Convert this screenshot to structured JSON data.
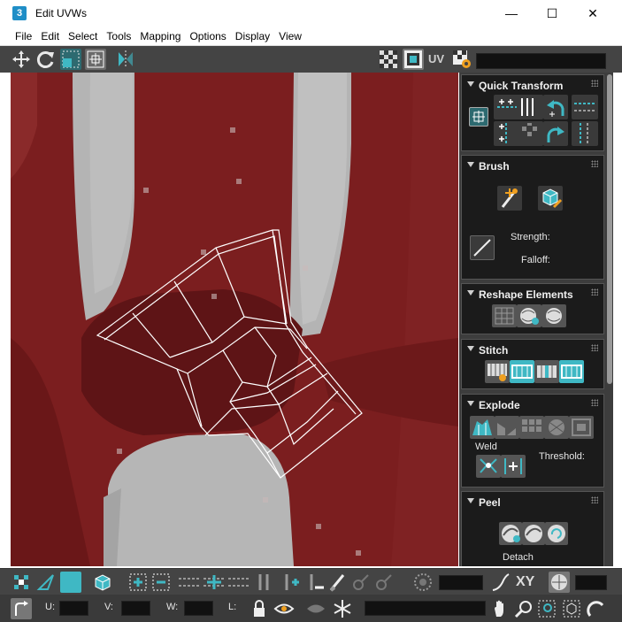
{
  "window": {
    "app_icon_label": "3",
    "title": "Edit UVWs",
    "minimize": "—",
    "maximize": "☐",
    "close": "✕"
  },
  "menu": [
    "File",
    "Edit",
    "Select",
    "Tools",
    "Mapping",
    "Options",
    "Display",
    "View"
  ],
  "toolbar": {
    "uv_label": "UV"
  },
  "panels": {
    "quick_transform": {
      "title": "Quick Transform"
    },
    "brush": {
      "title": "Brush",
      "strength_label": "Strength:",
      "falloff_label": "Falloff:"
    },
    "reshape": {
      "title": "Reshape Elements"
    },
    "stitch": {
      "title": "Stitch"
    },
    "explode": {
      "title": "Explode",
      "weld_label": "Weld",
      "threshold_label": "Threshold:"
    },
    "peel": {
      "title": "Peel",
      "detach_label": "Detach"
    }
  },
  "bottom": {
    "xy_label": "XY"
  },
  "status": {
    "u_label": "U:",
    "v_label": "V:",
    "w_label": "W:",
    "l_label": "L:"
  },
  "colors": {
    "accent": "#3fb8c4",
    "texture_red": "#7a1d1e",
    "panel_bg": "#1b1b1b",
    "toolbar_bg": "#444444"
  }
}
